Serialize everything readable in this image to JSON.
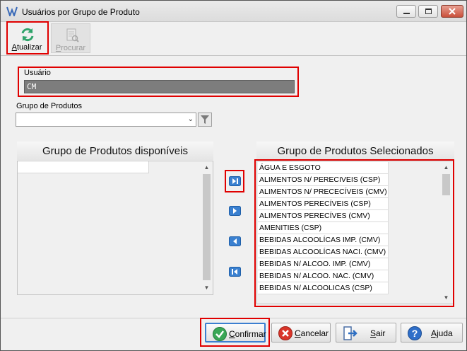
{
  "window": {
    "title": "Usuários por Grupo de Produto"
  },
  "toolbar": {
    "atualizar": {
      "label_first": "A",
      "label_rest": "tualizar",
      "icon": "refresh-icon"
    },
    "procurar": {
      "label_first": "P",
      "label_rest": "rocurar",
      "icon": "search-document-icon"
    }
  },
  "usuario": {
    "label": "Usuário",
    "value": "CM"
  },
  "grupo": {
    "label": "Grupo de Produtos",
    "value": ""
  },
  "disponiveis": {
    "title": "Grupo de Produtos disponíveis",
    "items": []
  },
  "selecionados": {
    "title": "Grupo de Produtos Selecionados",
    "items": [
      "ÁGUA E ESGOTO",
      "ALIMENTOS N/ PERECIVEIS  (CSP)",
      "ALIMENTOS N/ PRECECÍVEIS (CMV)",
      "ALIMENTOS PERECÍVEIS (CSP)",
      "ALIMENTOS PERECÍVES (CMV)",
      "AMENITIES (CSP)",
      "BEBIDAS ALCOOLÍCAS IMP. (CMV)",
      "BEBIDAS ALCOOLÍCAS NACI. (CMV)",
      "BEBIDAS N/ ALCOO. IMP. (CMV)",
      "BEBIDAS N/ ALCOO. NAC. (CMV)",
      "BEBIDAS N/ ALCOOLICAS (CSP)"
    ]
  },
  "buttons": {
    "confirmar": {
      "first": "C",
      "rest": "onfirmar"
    },
    "cancelar": {
      "first": "C",
      "rest": "ancelar"
    },
    "sair": {
      "first": "S",
      "rest": "air"
    },
    "ajuda": {
      "first": "Aj",
      "rest": "uda"
    }
  },
  "colors": {
    "highlight_red": "#e00000",
    "focus_blue": "#3c7fd0",
    "user_field_bg": "#7d7d7d"
  }
}
